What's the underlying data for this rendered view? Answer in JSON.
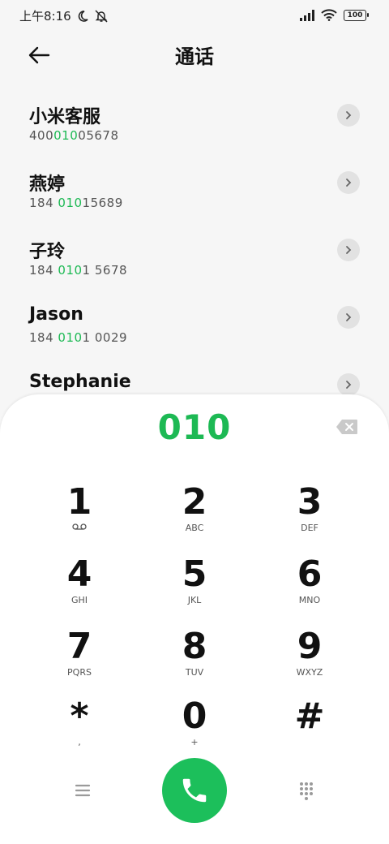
{
  "status_bar": {
    "time": "上午8:16",
    "battery": "100"
  },
  "header": {
    "title": "通话"
  },
  "contacts": [
    {
      "name": "小米客服",
      "num_pre": "400",
      "num_hl": "010",
      "num_post": "05678"
    },
    {
      "name": "燕婷",
      "num_pre": "184 ",
      "num_hl": "010",
      "num_post": "15689"
    },
    {
      "name": "子玲",
      "num_pre": "184 ",
      "num_hl": "010",
      "num_post": "1 5678"
    },
    {
      "name": "Jason",
      "num_pre": "184 ",
      "num_hl": "010",
      "num_post": "1 0029"
    },
    {
      "name": "Stephanie",
      "num_pre": "",
      "num_hl": "",
      "num_post": ""
    }
  ],
  "dialer": {
    "entered_number": "010",
    "keys": [
      {
        "digit": "1",
        "letters": ""
      },
      {
        "digit": "2",
        "letters": "ABC"
      },
      {
        "digit": "3",
        "letters": "DEF"
      },
      {
        "digit": "4",
        "letters": "GHI"
      },
      {
        "digit": "5",
        "letters": "JKL"
      },
      {
        "digit": "6",
        "letters": "MNO"
      },
      {
        "digit": "7",
        "letters": "PQRS"
      },
      {
        "digit": "8",
        "letters": "TUV"
      },
      {
        "digit": "9",
        "letters": "WXYZ"
      },
      {
        "digit": "*",
        "letters": ","
      },
      {
        "digit": "0",
        "letters": "+"
      },
      {
        "digit": "#",
        "letters": ""
      }
    ]
  },
  "colors": {
    "accent": "#1db954",
    "call_button": "#1cbf5b"
  },
  "icons": {
    "status_left": [
      "moon-icon",
      "muted-bell-icon"
    ],
    "status_right": [
      "signal-icon",
      "wifi-icon",
      "battery-icon"
    ],
    "back": "back-arrow-icon",
    "row_action": "chevron-right-icon",
    "backspace": "backspace-icon",
    "voicemail": "voicemail-icon",
    "menu": "menu-icon",
    "call": "phone-icon",
    "keypad": "keypad-icon"
  }
}
